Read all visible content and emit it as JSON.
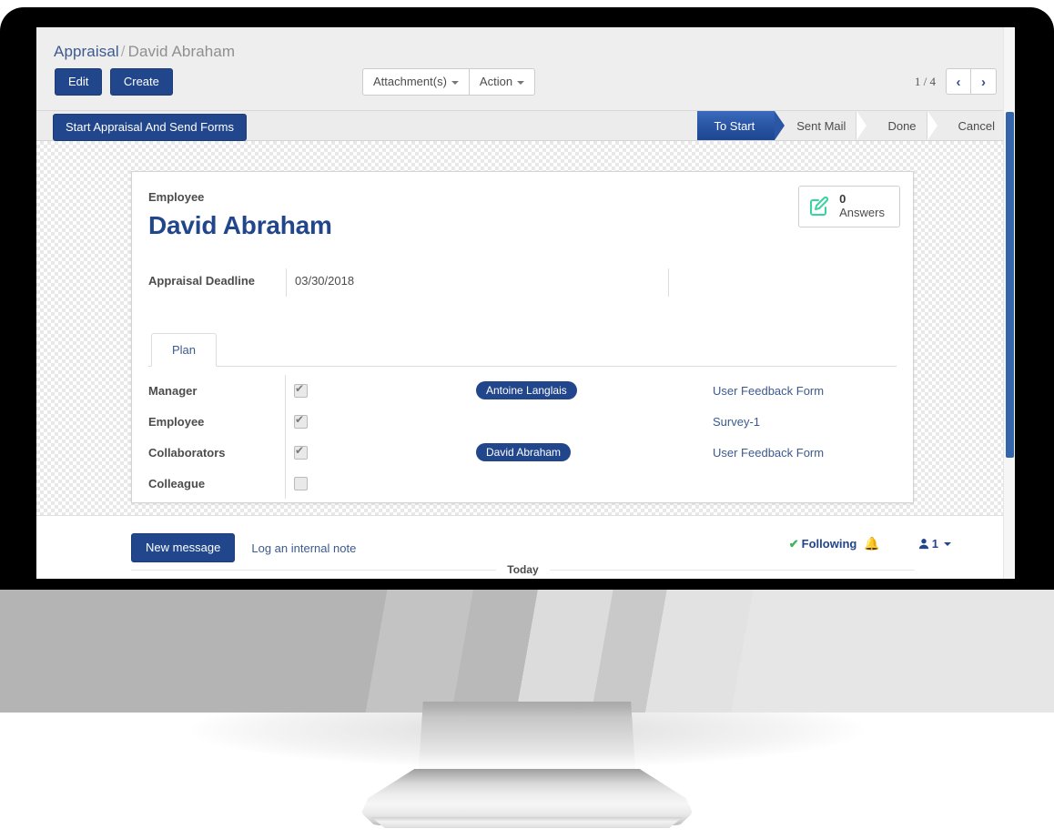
{
  "breadcrumb": {
    "root": "Appraisal",
    "separator": "/",
    "current": "David Abraham"
  },
  "toolbar": {
    "edit_label": "Edit",
    "create_label": "Create",
    "attachments_label": "Attachment(s)",
    "action_label": "Action"
  },
  "pager": {
    "count": "1 / 4",
    "prev_glyph": "‹",
    "next_glyph": "›"
  },
  "workflow": {
    "button_label": "Start Appraisal And Send Forms",
    "states": [
      {
        "label": "To Start",
        "active": true
      },
      {
        "label": "Sent Mail",
        "active": false
      },
      {
        "label": "Done",
        "active": false
      },
      {
        "label": "Cancel",
        "active": false
      }
    ]
  },
  "record": {
    "employee_label": "Employee",
    "name": "David Abraham",
    "deadline_label": "Appraisal Deadline",
    "deadline_value": "03/30/2018"
  },
  "stat_button": {
    "value": "0",
    "label": "Answers",
    "icon": "pencil-square-icon",
    "color": "#38d4a0"
  },
  "notebook": {
    "tabs": [
      {
        "label": "Plan",
        "active": true
      }
    ],
    "rows": [
      {
        "role": "Manager",
        "checked": true,
        "tag": "Antoine Langlais",
        "form": "User Feedback Form"
      },
      {
        "role": "Employee",
        "checked": true,
        "tag": "",
        "form": "Survey-1"
      },
      {
        "role": "Collaborators",
        "checked": true,
        "tag": "David Abraham",
        "form": "User Feedback Form"
      },
      {
        "role": "Colleague",
        "checked": false,
        "tag": "",
        "form": ""
      }
    ]
  },
  "chatter": {
    "new_message_label": "New message",
    "log_note_label": "Log an internal note",
    "following_label": "Following",
    "following_check": "✔",
    "bell_icon": "bell-icon",
    "followers_count": "1",
    "divider_label": "Today"
  },
  "colors": {
    "primary": "#21468b",
    "link": "#3c5a8f",
    "active_state": "#2a56a5",
    "stat_icon": "#38d4a0",
    "following_check": "#41b45f",
    "scrollbar": "#3465ac"
  }
}
